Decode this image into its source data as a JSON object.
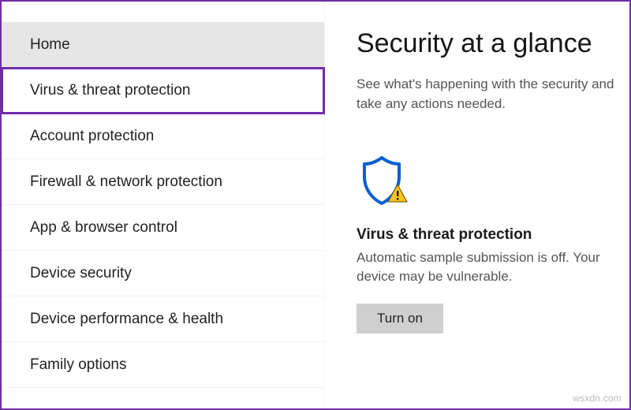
{
  "sidebar": {
    "items": [
      {
        "label": "Home",
        "selected": true,
        "highlighted": false
      },
      {
        "label": "Virus & threat protection",
        "selected": false,
        "highlighted": true
      },
      {
        "label": "Account protection",
        "selected": false,
        "highlighted": false
      },
      {
        "label": "Firewall & network protection",
        "selected": false,
        "highlighted": false
      },
      {
        "label": "App & browser control",
        "selected": false,
        "highlighted": false
      },
      {
        "label": "Device security",
        "selected": false,
        "highlighted": false
      },
      {
        "label": "Device performance & health",
        "selected": false,
        "highlighted": false
      },
      {
        "label": "Family options",
        "selected": false,
        "highlighted": false
      }
    ]
  },
  "main": {
    "title": "Security at a glance",
    "subtitle": "See what's happening with the security and take any actions needed.",
    "card": {
      "title": "Virus & threat protection",
      "body": "Automatic sample submission is off. Your device may be vulnerable.",
      "button": "Turn on"
    }
  },
  "watermark": "wsxdn.com",
  "colors": {
    "accent": "#6f2da8",
    "shield_stroke": "#0a5fd6",
    "warn_fill": "#f8c31a"
  }
}
